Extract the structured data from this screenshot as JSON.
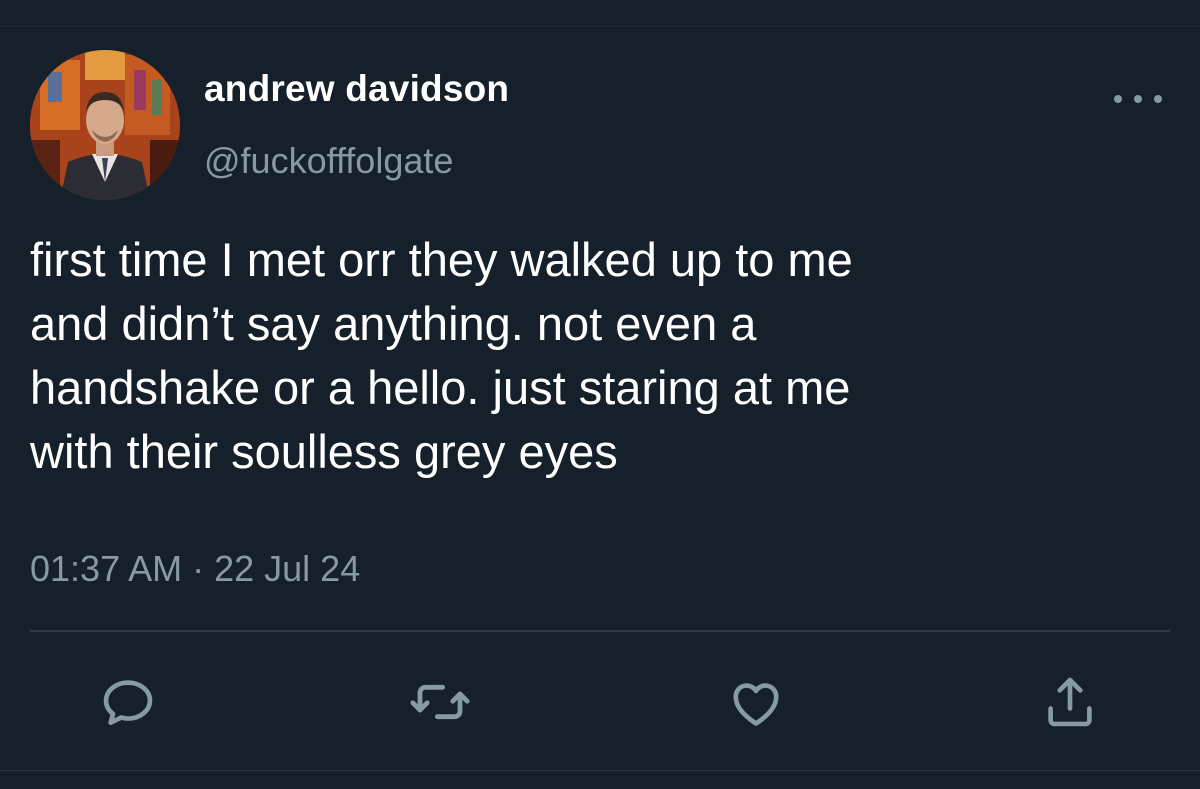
{
  "tweet": {
    "author": {
      "display_name": "andrew davidson",
      "handle": "@fuckofffolgate"
    },
    "text_lines": [
      "first time I met orr they walked up to me",
      "and didn’t say anything. not even a",
      "handshake or a hello. just staring at me",
      "with their soulless grey eyes"
    ],
    "time": "01:37 AM",
    "separator": "·",
    "date": "22 Jul 24"
  },
  "actions": [
    "reply-icon",
    "retweet-icon",
    "like-icon",
    "share-icon"
  ],
  "colors": {
    "background": "#15202b",
    "text": "#ffffff",
    "secondary": "#8899a6",
    "divider": "#2f3b47"
  }
}
